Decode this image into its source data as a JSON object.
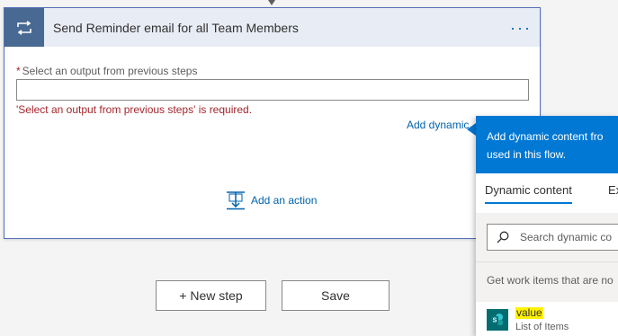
{
  "action_card": {
    "title": "Send Reminder email for all Team Members",
    "icon": "loop-icon",
    "more_label": "···",
    "field": {
      "required_mark": "*",
      "label": "Select an output from previous steps",
      "value": "",
      "placeholder": ""
    },
    "error": "'Select an output from previous steps' is required.",
    "add_dynamic_link": "Add dynamic",
    "add_action_label": "Add an action"
  },
  "buttons": {
    "new_step": "+ New step",
    "save": "Save"
  },
  "flyout": {
    "header_line1": "Add dynamic content fro",
    "header_line2": "used in this flow.",
    "tabs": [
      "Dynamic content",
      "Ex"
    ],
    "search_placeholder": "Search dynamic co",
    "section_header": "Get work items that are no",
    "items": [
      {
        "name": "value",
        "description": "List of Items",
        "icon": "sharepoint-icon"
      }
    ]
  },
  "colors": {
    "accent": "#0078d4",
    "link": "#0062ad",
    "header_icon_bg": "#486991",
    "error": "#a4262c",
    "highlight": "#fff200"
  }
}
